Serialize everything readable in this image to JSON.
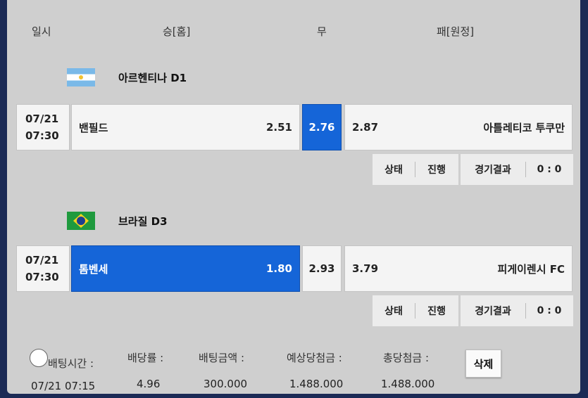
{
  "header": {
    "date": "일시",
    "home": "승[홈]",
    "draw": "무",
    "away": "패[원정]"
  },
  "matches": [
    {
      "league": "아르헨티나 D1",
      "flag": "argentina-flag",
      "date": "07/21",
      "time": "07:30",
      "home_team": "밴필드",
      "home_odds": "2.51",
      "draw_odds": "2.76",
      "away_odds": "2.87",
      "away_team": "아틀레티코 투쿠만",
      "selected": "draw",
      "status_label": "상태",
      "status_value": "진행",
      "result_label": "경기결과",
      "result_value": "0 : 0"
    },
    {
      "league": "브라질 D3",
      "flag": "brazil-flag",
      "date": "07/21",
      "time": "07:30",
      "home_team": "톰벤세",
      "home_odds": "1.80",
      "draw_odds": "2.93",
      "away_odds": "3.79",
      "away_team": "피게이렌시 FC",
      "selected": "home",
      "status_label": "상태",
      "status_value": "진행",
      "result_label": "경기결과",
      "result_value": "0 : 0"
    }
  ],
  "summary": {
    "bet_time_label": "배팅시간 :",
    "bet_time_value": "07/21 07:15",
    "odds_label": "배당률 :",
    "odds_value": "4.96",
    "amount_label": "배팅금액 :",
    "amount_value": "300.000",
    "expected_label": "예상당첨금 :",
    "expected_value": "1.488.000",
    "total_label": "총당첨금 :",
    "total_value": "1.488.000",
    "delete_label": "삭제"
  },
  "colors": {
    "selected": "#1565d8",
    "panel": "#cfcfcf",
    "background": "#1b2a55"
  }
}
